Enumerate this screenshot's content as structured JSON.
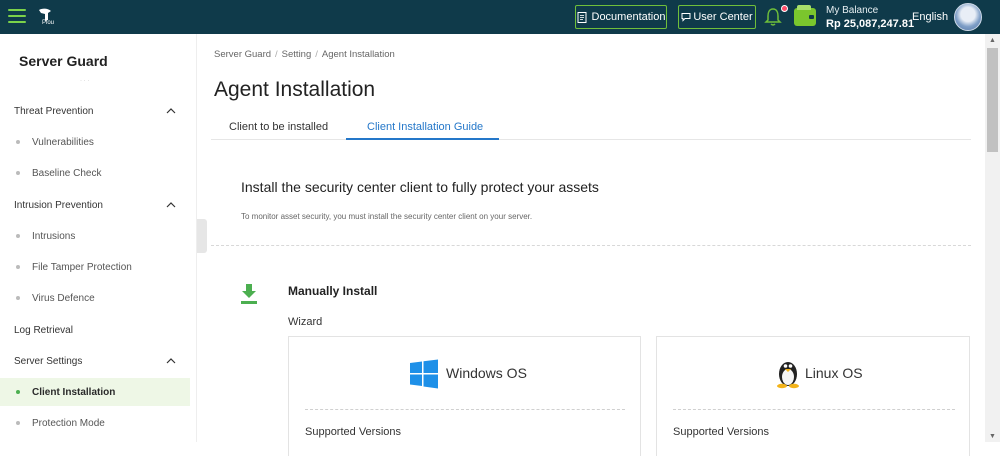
{
  "topbar": {
    "brand": "Plou",
    "documentation_label": "Documentation",
    "user_center_label": "User Center",
    "balance_label": "My Balance",
    "balance_value": "Rp 25,087,247.81",
    "language": "English",
    "accent_color": "#6fbf3a",
    "bg_color": "#0f3a4a"
  },
  "sidebar": {
    "title": "Server Guard",
    "items": [
      {
        "label": "Threat Prevention",
        "type": "group",
        "expanded": true
      },
      {
        "label": "Vulnerabilities",
        "type": "sub"
      },
      {
        "label": "Baseline Check",
        "type": "sub"
      },
      {
        "label": "Intrusion Prevention",
        "type": "group",
        "expanded": true
      },
      {
        "label": "Intrusions",
        "type": "sub"
      },
      {
        "label": "File Tamper Protection",
        "type": "sub"
      },
      {
        "label": "Virus Defence",
        "type": "sub"
      },
      {
        "label": "Log Retrieval",
        "type": "group"
      },
      {
        "label": "Server Settings",
        "type": "group",
        "expanded": true
      },
      {
        "label": "Client Installation",
        "type": "sub",
        "active": true
      },
      {
        "label": "Protection Mode",
        "type": "sub"
      }
    ]
  },
  "breadcrumb": {
    "items": [
      "Server Guard",
      "Setting",
      "Agent Installation"
    ]
  },
  "page": {
    "title": "Agent Installation",
    "tabs": [
      "Client to be installed",
      "Client Installation Guide"
    ],
    "active_tab": "Client Installation Guide",
    "section_heading": "Install the security center client to fully protect your assets",
    "section_desc": "To monitor asset security, you must install the security center client on your server.",
    "manual_title": "Manually Install",
    "wizard_label": "Wizard",
    "os_cards": [
      {
        "name": "Windows OS",
        "icon": "windows-icon",
        "supported_label": "Supported Versions"
      },
      {
        "name": "Linux OS",
        "icon": "linux-tux-icon",
        "supported_label": "Supported Versions"
      }
    ]
  }
}
